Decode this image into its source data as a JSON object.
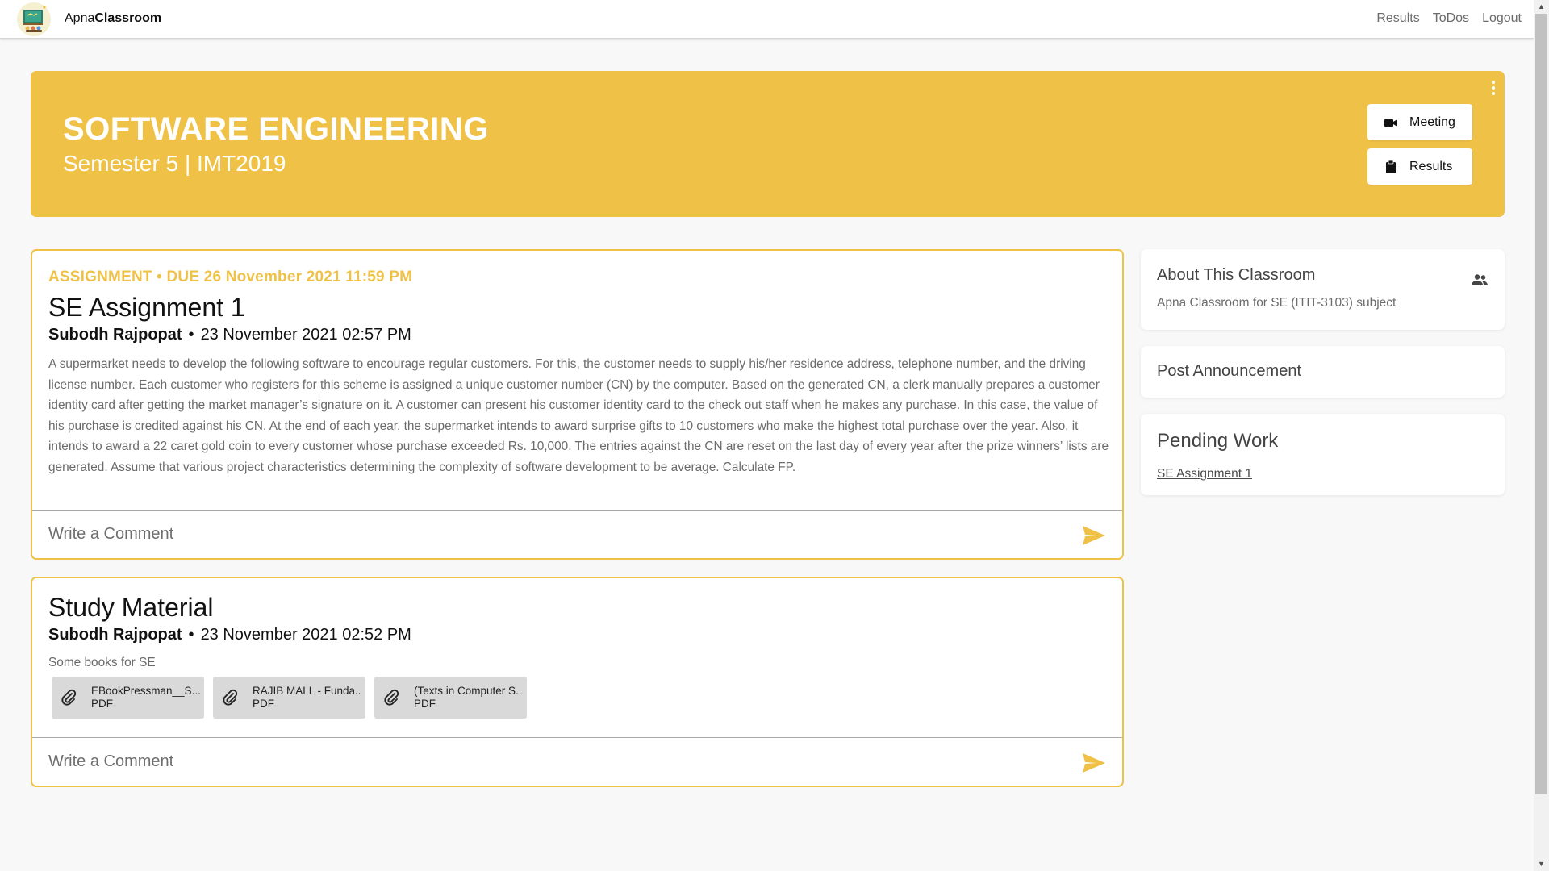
{
  "navbar": {
    "brand_prefix": "Apna",
    "brand_suffix": "Classroom",
    "links": [
      "Results",
      "ToDos",
      "Logout"
    ]
  },
  "banner": {
    "title": "SOFTWARE ENGINEERING",
    "subtitle": "Semester 5 | IMT2019",
    "meeting_label": "Meeting",
    "results_label": "Results"
  },
  "assignment_post": {
    "meta": "ASSIGNMENT • DUE 26 November 2021 11:59 PM",
    "title": "SE Assignment 1",
    "author": "Subodh Rajpopat",
    "separator": "•",
    "timestamp": "23 November 2021 02:57 PM",
    "body": "A supermarket needs to develop the following software to encourage regular customers. For this, the customer needs to supply his/her residence address, telephone number, and the driving license number. Each customer who registers for this scheme is assigned a unique customer number (CN) by the computer. Based on the generated CN, a clerk manually prepares a customer identity card after getting the market manager’s signature on it. A customer can present his customer identity card to the check out staff when he makes any purchase. In this case, the value of his purchase is credited against his CN. At the end of each year, the supermarket intends to award surprise gifts to 10 customers who make the highest total purchase over the year. Also, it intends to award a 22 caret gold coin to every customer whose purchase exceeded Rs. 10,000. The entries against the CN are reset on the last day of every year after the prize winners’ lists are generated. Assume that various project characteristics determining the complexity of software development to be average. Calculate FP.",
    "comment_placeholder": "Write a Comment"
  },
  "material_post": {
    "title": "Study Material",
    "author": "Subodh Rajpopat",
    "separator": "•",
    "timestamp": "23 November 2021 02:52 PM",
    "description": "Some books for SE",
    "attachments": [
      {
        "name": "EBookPressman__S...",
        "type": "PDF"
      },
      {
        "name": "RAJIB MALL - Funda...",
        "type": "PDF"
      },
      {
        "name": "(Texts in Computer S...",
        "type": "PDF"
      }
    ],
    "comment_placeholder": "Write a Comment"
  },
  "sidebar": {
    "about_heading": "About This Classroom",
    "about_text": "Apna Classroom for SE (ITIT-3103) subject",
    "post_announcement": "Post Announcement",
    "pending_heading": "Pending Work",
    "pending_items": [
      "SE Assignment 1"
    ]
  },
  "colors": {
    "accent": "#efc247",
    "background": "#f8f8f8",
    "muted_text": "#6b6b6b"
  },
  "icons": {
    "meeting": "video-camera-icon",
    "results": "clipboard-icon",
    "send": "send-icon",
    "attachment": "paperclip-icon",
    "people": "people-icon",
    "more": "kebab-menu-icon"
  }
}
